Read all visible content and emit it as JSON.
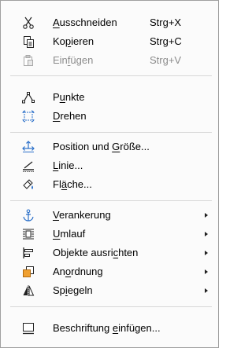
{
  "menu": {
    "items": [
      {
        "pre": "",
        "acc": "A",
        "post": "usschneiden",
        "shortcut": "Strg+X",
        "icon": "scissors-icon",
        "disabled": false
      },
      {
        "pre": "Ko",
        "acc": "p",
        "post": "ieren",
        "shortcut": "Strg+C",
        "icon": "copy-icon",
        "disabled": false
      },
      {
        "pre": "Ein",
        "acc": "f",
        "post": "ügen",
        "shortcut": "Strg+V",
        "icon": "paste-icon",
        "disabled": true
      },
      {
        "pre": "P",
        "acc": "u",
        "post": "nkte",
        "shortcut": "",
        "icon": "points-icon",
        "disabled": false
      },
      {
        "pre": "",
        "acc": "D",
        "post": "rehen",
        "shortcut": "",
        "icon": "rotate-icon",
        "disabled": false
      },
      {
        "pre": "Position und ",
        "acc": "G",
        "post": "röße...",
        "shortcut": "",
        "icon": "position-size-icon",
        "disabled": false
      },
      {
        "pre": "",
        "acc": "L",
        "post": "inie...",
        "shortcut": "",
        "icon": "line-icon",
        "disabled": false
      },
      {
        "pre": "Fl",
        "acc": "ä",
        "post": "che...",
        "shortcut": "",
        "icon": "area-icon",
        "disabled": false
      },
      {
        "pre": "",
        "acc": "V",
        "post": "erankerung",
        "shortcut": "",
        "icon": "anchor-icon",
        "submenu": true,
        "disabled": false
      },
      {
        "pre": "",
        "acc": "U",
        "post": "mlauf",
        "shortcut": "",
        "icon": "wrap-icon",
        "submenu": true,
        "disabled": false
      },
      {
        "pre": "Objekte ausri",
        "acc": "c",
        "post": "hten",
        "shortcut": "",
        "icon": "align-objects-icon",
        "submenu": true,
        "disabled": false
      },
      {
        "pre": "An",
        "acc": "o",
        "post": "rdnung",
        "shortcut": "",
        "icon": "arrange-icon",
        "submenu": true,
        "disabled": false
      },
      {
        "pre": "Sp",
        "acc": "i",
        "post": "egeln",
        "shortcut": "",
        "icon": "mirror-icon",
        "submenu": true,
        "disabled": false
      },
      {
        "pre": "Beschriftung ",
        "acc": "e",
        "post": "infügen...",
        "shortcut": "",
        "icon": "insert-caption-icon",
        "disabled": false
      }
    ]
  }
}
